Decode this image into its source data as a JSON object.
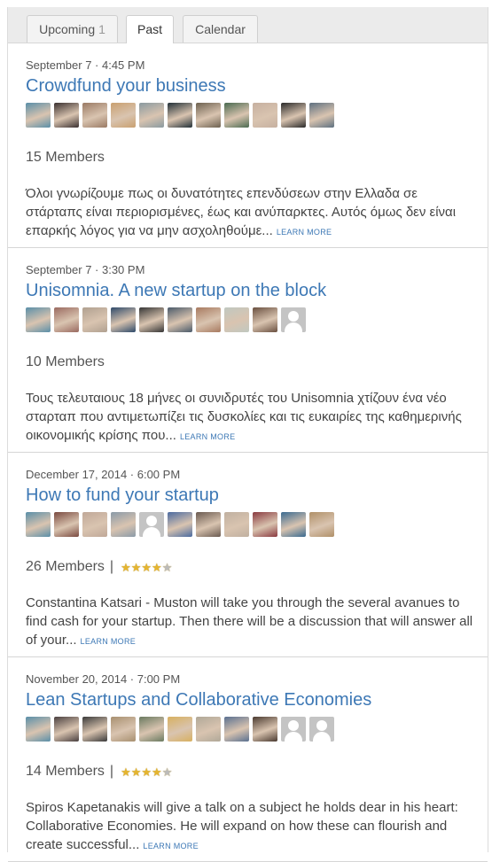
{
  "tabs": [
    {
      "label": "Upcoming",
      "count": "1"
    },
    {
      "label": "Past",
      "count": ""
    },
    {
      "label": "Calendar",
      "count": ""
    }
  ],
  "learn_more": "LEARN MORE",
  "events": [
    {
      "date": "September 7 · 4:45 PM",
      "title": "Crowdfund your business",
      "members": "15 Members",
      "rated": false,
      "description": "Όλοι γνωρίζουμε πως οι δυνατότητες επενδύσεων στην Ελλαδα σε στάρταπς είναι περιορισμένες, έως και ανύπαρκτες. Αυτός όμως δεν είναι επαρκής λόγος για να μην ασχοληθούμε...",
      "avatars": [
        "#5a8fa8",
        "#3a3030",
        "#9a7a64",
        "#c9a070",
        "#8a9aa0",
        "#223038",
        "#6d6150",
        "#4a6a50",
        "#c6b0a0",
        "#2a2a2a",
        "#5e7080"
      ]
    },
    {
      "date": "September 7 · 3:30 PM",
      "title": "Unisomnia. A new startup on the block",
      "members": "10 Members",
      "rated": false,
      "description": "Τους τελευταιους 18 μήνες οι συνιδρυτές του Unisomnia χτίζουν ένα νέο σταρταπ που αντιμετωπίζει τις δυσκολίες και τις ευκαιρίες της καθημερινής οικονομικής κρίσης που...",
      "avatars": [
        "#5a8fa8",
        "#9a6a60",
        "#b0a090",
        "#2e4a6a",
        "#353535",
        "#4a5a6a",
        "#a87a60",
        "#c0c8c0",
        "#6a5040",
        "generic"
      ]
    },
    {
      "date": "December 17, 2014 · 6:00 PM",
      "title": "How to fund your startup",
      "members": "26 Members",
      "rated": true,
      "rating": 4.5,
      "description": "Constantina Katsari - Muston will take you through the several avanues to find cash for your startup. Then there will be a discussion that will answer all of your...",
      "avatars": [
        "#5a8fa8",
        "#7a4a40",
        "#c0a898",
        "#8a9aa8",
        "generic",
        "#4a6aa0",
        "#6a5a50",
        "#c0b0a0",
        "#8a3a40",
        "#3a6a90",
        "#b09068"
      ]
    },
    {
      "date": "November 20, 2014 · 7:00 PM",
      "title": "Lean Startups and Collaborative Economies",
      "members": "14 Members",
      "rated": true,
      "rating": 4.5,
      "description": "Spiros Kapetanakis will give a talk on a subject he holds dear in his heart: Collaborative Economies. He will expand on how these can flourish and create successful...",
      "avatars": [
        "#5a8fa8",
        "#4a4040",
        "#3a3a3a",
        "#a89070",
        "#6a7a60",
        "#d8b060",
        "#b0a898",
        "#5a7090",
        "#4a3a30",
        "generic",
        "generic"
      ]
    }
  ]
}
